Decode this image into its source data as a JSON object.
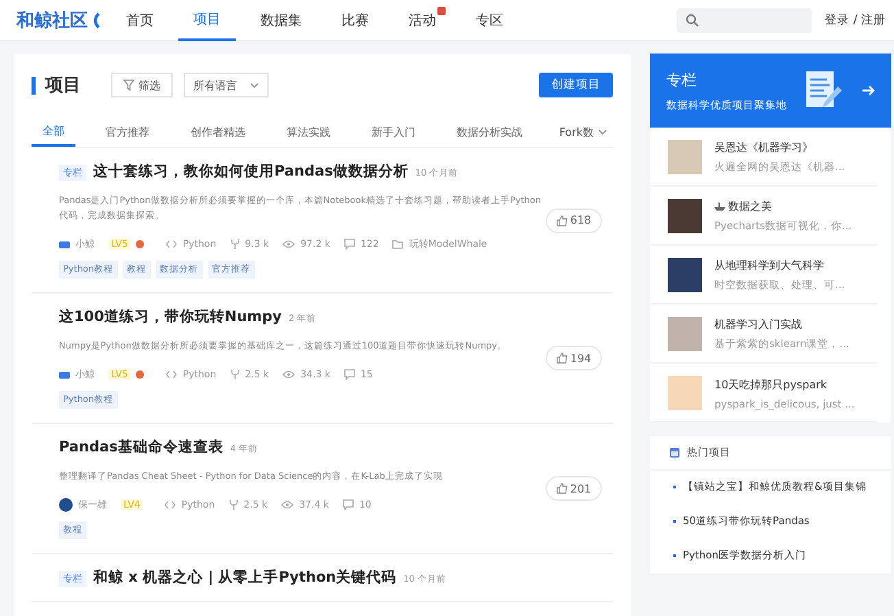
{
  "header": {
    "logo": "和鲸社区",
    "nav": [
      {
        "label": "首页",
        "selected": false,
        "badge": false
      },
      {
        "label": "项目",
        "selected": true,
        "badge": false
      },
      {
        "label": "数据集",
        "selected": false,
        "badge": false
      },
      {
        "label": "比赛",
        "selected": false,
        "badge": false
      },
      {
        "label": "活动",
        "selected": false,
        "badge": true
      },
      {
        "label": "专区",
        "selected": false,
        "badge": false
      }
    ],
    "auth": "登录 / 注册"
  },
  "projects_panel": {
    "title": "项目",
    "filter_button": "筛选",
    "language_select": "所有语言",
    "create_button": "创建项目",
    "tabs": [
      {
        "label": "全部",
        "selected": true
      },
      {
        "label": "官方推荐",
        "selected": false
      },
      {
        "label": "创作者精选",
        "selected": false
      },
      {
        "label": "算法实践",
        "selected": false
      },
      {
        "label": "新手入门",
        "selected": false
      },
      {
        "label": "数据分析实战",
        "selected": false
      }
    ],
    "sort": "Fork数",
    "projects": [
      {
        "tag": "专栏",
        "title": "这十套练习，教你如何使用Pandas做数据分析",
        "time": "10 个月前",
        "desc": "Pandas是入门Python做数据分析所必须要掌握的一个库，本篇Notebook精选了十套练习题，帮助读者上手Python代码，完成数据集探索。",
        "author": "小鲸",
        "level": "LV5",
        "medal": true,
        "language": "Python",
        "forks": "9.3 k",
        "views": "97.2 k",
        "comments": "122",
        "collection": "玩转ModelWhale",
        "tags": [
          "Python教程",
          "教程",
          "数据分析",
          "官方推荐"
        ],
        "likes": "618"
      },
      {
        "title": "这100道练习，带你玩转Numpy",
        "time": "2 年前",
        "desc": "Numpy是Python做数据分析所必须要掌握的基础库之一，这篇练习通过100道题目带你快速玩转Numpy。",
        "author": "小鲸",
        "level": "LV5",
        "medal": true,
        "language": "Python",
        "forks": "2.5 k",
        "views": "34.3 k",
        "comments": "15",
        "tags": [
          "Python教程"
        ],
        "likes": "194"
      },
      {
        "title": "Pandas基础命令速查表",
        "time": "4 年前",
        "desc": "整理翻译了Pandas Cheat Sheet - Python for Data Science的内容，在K-Lab上完成了实现",
        "author": "保一雄",
        "level": "LV4",
        "medal": false,
        "language": "Python",
        "forks": "2.5 k",
        "views": "37.4 k",
        "comments": "10",
        "tags": [
          "教程"
        ],
        "likes": "201"
      },
      {
        "tag": "专栏",
        "title": "和鲸 x 机器之心 | 从零上手Python关键代码",
        "time": "10 个月前"
      }
    ]
  },
  "column_card": {
    "title": "专栏",
    "subtitle": "数据科学优质项目聚集地",
    "items": [
      {
        "title": "吴恩达《机器学习》",
        "desc": "火遍全网的吴恩达《机器...",
        "title_icon": false
      },
      {
        "title": "数据之美",
        "desc": "Pyecharts数据可视化，你...",
        "title_icon": true
      },
      {
        "title": "从地理科学到大气科学",
        "desc": "时空数据获取、处理、可...",
        "title_icon": false
      },
      {
        "title": "机器学习入门实战",
        "desc": "基于紫紫的sklearn课堂，...",
        "title_icon": false
      },
      {
        "title": "10天吃掉那只pyspark",
        "desc": "pyspark_is_delicous, just ...",
        "title_icon": false
      }
    ]
  },
  "hot_projects": {
    "title": "热门项目",
    "items": [
      "【镇站之宝】和鲸优质教程&项目集锦",
      "50道练习带你玩转Pandas",
      "Python医学数据分析入门"
    ]
  }
}
